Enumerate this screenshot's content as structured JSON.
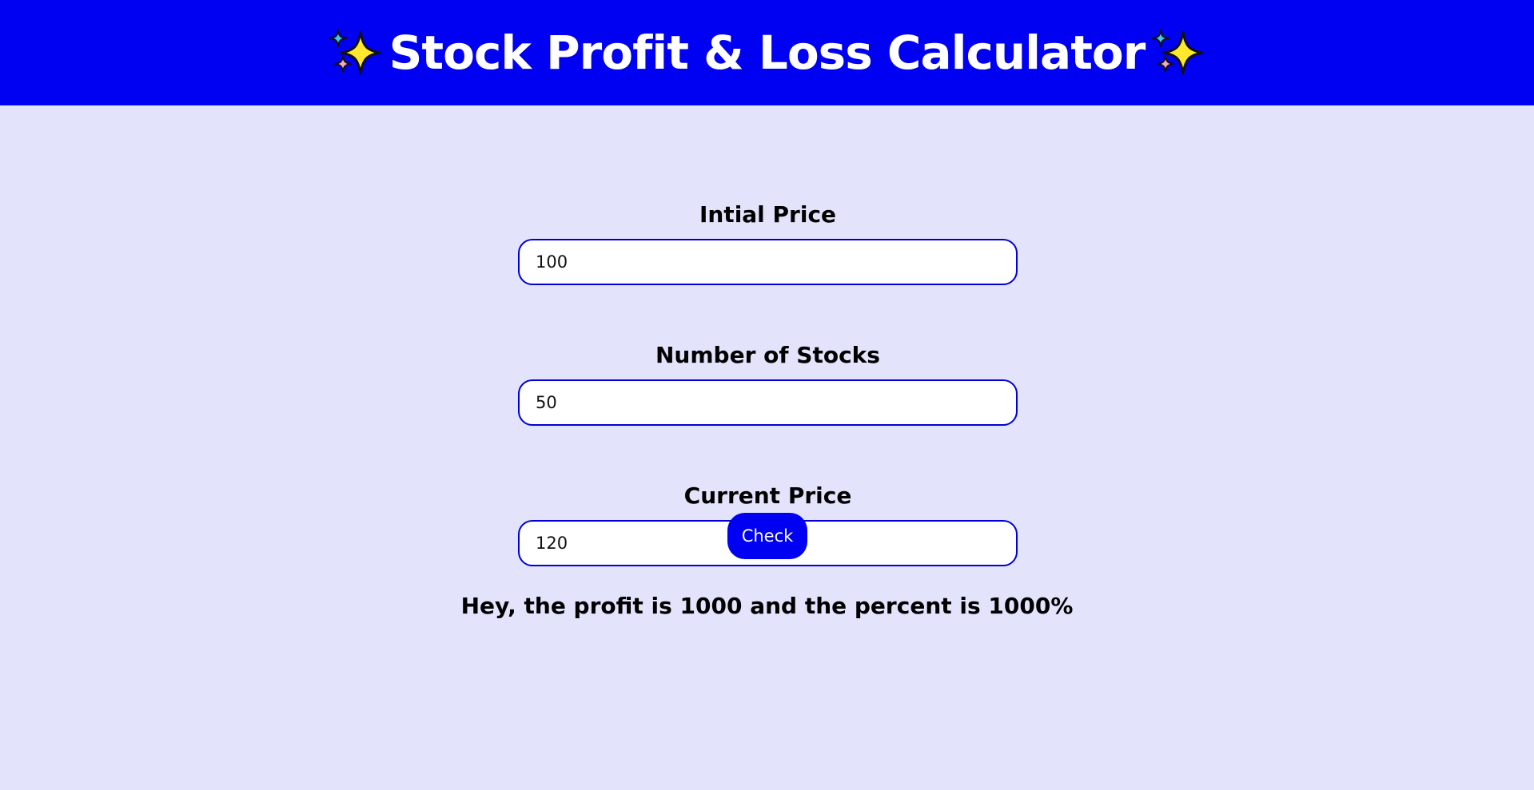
{
  "header": {
    "title": "Stock Profit & Loss Calculator",
    "left_icon": "sparkles-icon",
    "right_icon": "sparkles-icon",
    "background_color": "#0000f2"
  },
  "form": {
    "initial_price": {
      "label": "Intial Price",
      "value": "100"
    },
    "number_of_stocks": {
      "label": "Number of Stocks",
      "value": "50"
    },
    "current_price": {
      "label": "Current Price",
      "value": "120"
    },
    "check_button_label": "Check"
  },
  "result": {
    "message": "Hey, the profit is 1000 and the percent is 1000%"
  },
  "colors": {
    "accent": "#0000f2",
    "page_background": "#e3e3fc",
    "input_border": "#0000d6"
  }
}
